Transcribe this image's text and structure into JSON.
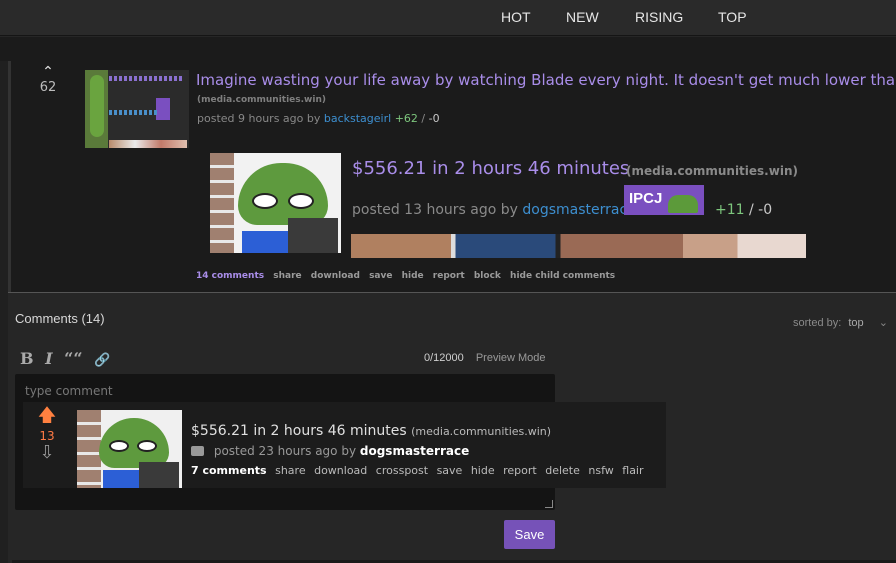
{
  "nav": {
    "tabs": [
      {
        "label": "HOT"
      },
      {
        "label": "NEW"
      },
      {
        "label": "RISING"
      },
      {
        "label": "TOP"
      }
    ]
  },
  "post": {
    "score": "62",
    "title": "Imagine wasting your life away by watching Blade every night. It doesn't get much lower than that!",
    "domain": "(media.communities.win)",
    "posted": "posted 9 hours ago by",
    "author": "backstageirl",
    "upvotes": "+62",
    "separator": "/",
    "downvotes": "-0",
    "embed": {
      "title": "$556.21 in 2 hours 46 minutes",
      "domain": "(media.communities.win)",
      "posted": "posted 13 hours ago by",
      "author": "dogsmasterrace",
      "flair": "IPCJ",
      "upvotes": "+11",
      "separator": "/",
      "downvotes": "-0"
    },
    "actions": {
      "comments": "14 comments",
      "share": "share",
      "download": "download",
      "save": "save",
      "hide": "hide",
      "report": "report",
      "block": "block",
      "hide_child": "hide child comments"
    }
  },
  "comments_section": {
    "heading": "Comments (14)",
    "sorted_label": "sorted by:",
    "sorted_value": "top",
    "toolbar": {
      "bold": "B",
      "italic": "I",
      "quote": "““",
      "link": "🔗"
    },
    "counter": "0/12000",
    "preview_mode": "Preview Mode",
    "placeholder": "type comment",
    "save_label": "Save"
  },
  "preview_card": {
    "score": "13",
    "title": "$556.21 in 2 hours 46 minutes",
    "domain": "(media.communities.win)",
    "posted": "posted 23 hours ago by",
    "author": "dogsmasterrace",
    "actions": {
      "comments": "7 comments",
      "share": "share",
      "download": "download",
      "crosspost": "crosspost",
      "save": "save",
      "hide": "hide",
      "report": "report",
      "delete": "delete",
      "nsfw": "nsfw",
      "flair": "flair"
    }
  },
  "colors": {
    "accent_purple": "#a98de9",
    "button_purple": "#7652b8",
    "author_blue": "#3d8fd0",
    "upvote_green": "#7dc67d",
    "upvote_orange": "#ff8040"
  }
}
